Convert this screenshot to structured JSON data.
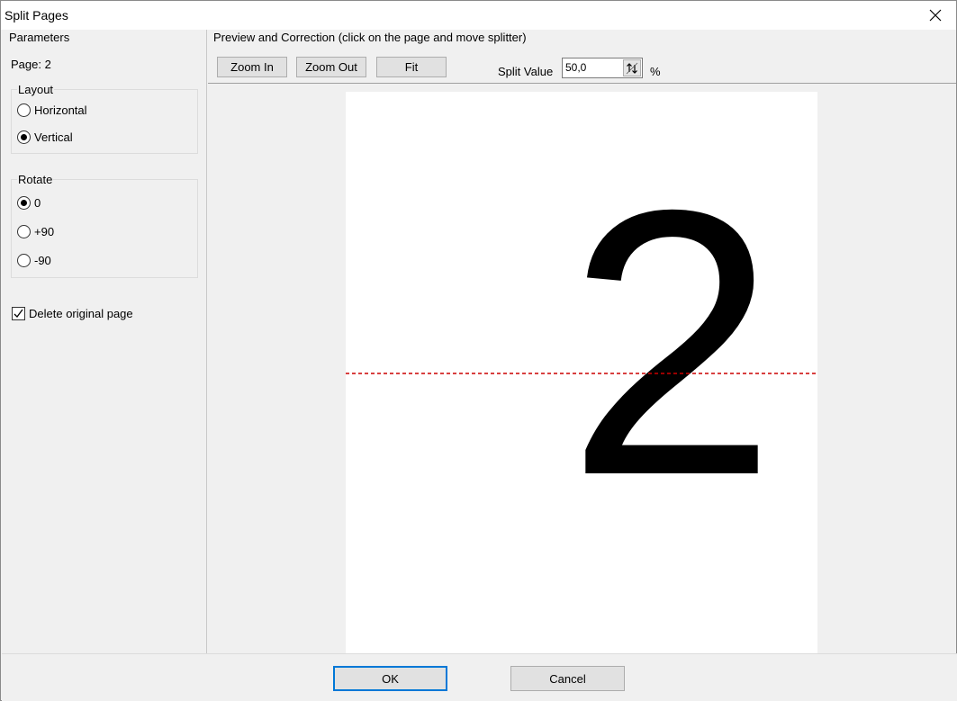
{
  "window": {
    "title": "Split Pages"
  },
  "parameters": {
    "caption": "Parameters",
    "page_label": "Page: 2",
    "layout": {
      "caption": "Layout",
      "options": [
        {
          "label": "Horizontal",
          "checked": false
        },
        {
          "label": "Vertical",
          "checked": true
        }
      ]
    },
    "rotate": {
      "caption": "Rotate",
      "options": [
        {
          "label": "0",
          "checked": true
        },
        {
          "label": "+90",
          "checked": false
        },
        {
          "label": "-90",
          "checked": false
        }
      ]
    },
    "delete_original": {
      "label": "Delete original page",
      "checked": true
    }
  },
  "preview": {
    "caption": "Preview and Correction (click on the page and move splitter)",
    "zoom_in_label": "Zoom In",
    "zoom_out_label": "Zoom Out",
    "fit_label": "Fit",
    "split_value_label": "Split Value",
    "split_value": "50,0",
    "split_unit": "%",
    "page_content": "2",
    "splitter_color": "#cc0000"
  },
  "footer": {
    "ok_label": "OK",
    "cancel_label": "Cancel"
  }
}
